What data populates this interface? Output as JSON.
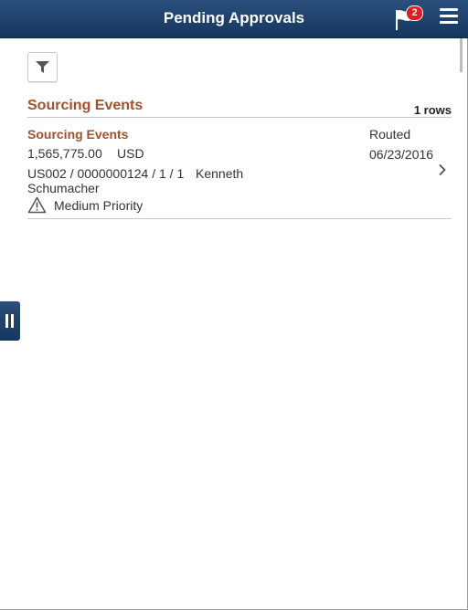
{
  "header": {
    "title": "Pending Approvals",
    "notification_count": "2",
    "notification_icon": "flag-icon",
    "menu_icon": "hamburger-menu-icon"
  },
  "toolbar": {
    "filter_icon": "filter-icon"
  },
  "group": {
    "title": "Sourcing Events",
    "rows_label": "1 rows"
  },
  "items": [
    {
      "title": "Sourcing Events",
      "amount": "1,565,775.00",
      "currency": "USD",
      "reference": "US002 / 0000000124 / 1 / 1",
      "requester_first": "Kenneth",
      "requester_last": "Schumacher",
      "priority": "Medium Priority",
      "status": "Routed",
      "date": "06/23/2016"
    }
  ],
  "colors": {
    "header_bg": "#1f426c",
    "accent_title": "#a0522d",
    "badge": "#e31b23"
  }
}
